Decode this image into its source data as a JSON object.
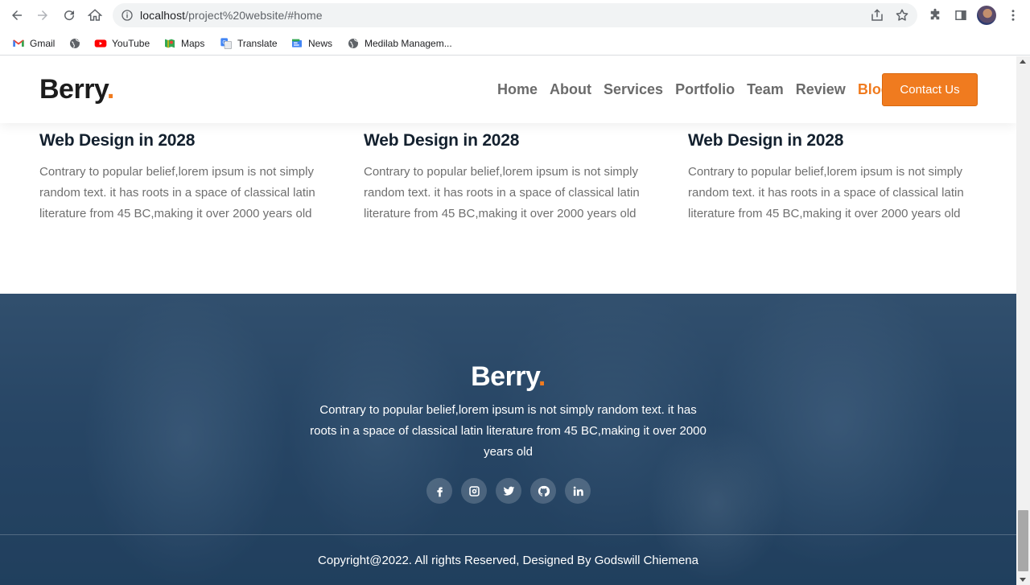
{
  "browser": {
    "url_host": "localhost",
    "url_path": "/project%20website/#home",
    "bookmarks": [
      {
        "label": "Gmail",
        "icon": "gmail-icon"
      },
      {
        "label": "",
        "icon": "globe-icon"
      },
      {
        "label": "YouTube",
        "icon": "youtube-icon"
      },
      {
        "label": "Maps",
        "icon": "maps-icon"
      },
      {
        "label": "Translate",
        "icon": "translate-icon"
      },
      {
        "label": "News",
        "icon": "news-icon"
      },
      {
        "label": "Medilab Managem...",
        "icon": "globe-icon"
      }
    ]
  },
  "header": {
    "logo": "Berry",
    "logo_dot": ".",
    "nav": [
      "Home",
      "About",
      "Services",
      "Portfolio",
      "Team",
      "Review",
      "Blog"
    ],
    "active_nav": "Blog",
    "contact_label": "Contact Us"
  },
  "blog": {
    "cards": [
      {
        "title": "Web Design in 2028",
        "description": "Contrary to popular belief,lorem ipsum is not simply random text. it has roots in a space of classical latin literature from 45 BC,making it over 2000 years old"
      },
      {
        "title": "Web Design in 2028",
        "description": "Contrary to popular belief,lorem ipsum is not simply random text. it has roots in a space of classical latin literature from 45 BC,making it over 2000 years old"
      },
      {
        "title": "Web Design in 2028",
        "description": "Contrary to popular belief,lorem ipsum is not simply random text. it has roots in a space of classical latin literature from 45 BC,making it over 2000 years old"
      }
    ]
  },
  "footer": {
    "logo": "Berry",
    "logo_dot": ".",
    "text": "Contrary to popular belief,lorem ipsum is not simply random text. it has roots in a space of classical latin literature from 45 BC,making it over 2000 years old",
    "socials": [
      "facebook-icon",
      "instagram-icon",
      "twitter-icon",
      "github-icon",
      "linkedin-icon"
    ],
    "copyright": "Copyright@2022. All rights Reserved, Designed By Godswill Chiemena"
  },
  "colors": {
    "accent": "#f07b1f",
    "heading": "#13202e",
    "body_text": "#6f6f6f",
    "footer_bg": "#2d4b6a"
  }
}
